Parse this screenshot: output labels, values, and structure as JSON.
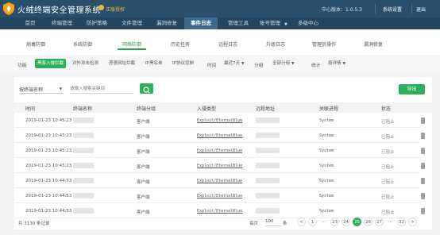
{
  "app": {
    "title": "火绒终端安全管理系统",
    "auth": "正版授权",
    "version": "中心版本：1.0.5.3",
    "settings": "系统设置",
    "exit": "退出"
  },
  "nav": {
    "items": [
      "首页",
      "终端管理",
      "防护策略",
      "文件管理",
      "漏洞修复",
      "事件日志",
      "管理工具",
      "账号管理",
      "多级中心"
    ],
    "active_index": 5
  },
  "subnav": {
    "items": [
      "病毒防御",
      "系统防御",
      "网络防御",
      "历史任务",
      "远程日志",
      "升级日志",
      "管理员操作",
      "漏洞修复"
    ],
    "active_index": 2
  },
  "toolbar": {
    "function_label": "功能",
    "function_buttons": [
      "黑客入侵拦截",
      "对外攻击检测",
      "恶意网址拦截",
      "IP黑名单",
      "IP协议控制"
    ],
    "function_active_index": 0,
    "time_label": "时间",
    "time_value": "最近7天",
    "group_label": "分组",
    "group_value": "全部分组",
    "stat_label": "统计",
    "stat_value": "按详情"
  },
  "filter": {
    "select_value": "按终端名称",
    "search_placeholder": "请输入搜索关键词",
    "export_label": "导出"
  },
  "table": {
    "headers": [
      "时间",
      "终端名称",
      "终端分组",
      "入侵类型",
      "远程地址",
      "关联进程",
      "状态"
    ],
    "rows": [
      {
        "time": "2019-01-23 10:45:23",
        "group": "客户端",
        "type": "Exploit/EternalBlue",
        "process": "System",
        "status": "已阻止"
      },
      {
        "time": "2019-01-23 10:45:23",
        "group": "客户端",
        "type": "Exploit/EternalBlue",
        "process": "System",
        "status": "已阻止"
      },
      {
        "time": "2019-01-23 10:45:23",
        "group": "客户端",
        "type": "Exploit/EternalBlue",
        "process": "System",
        "status": "已阻止"
      },
      {
        "time": "2019-01-23 10:45:23",
        "group": "客户端",
        "type": "Exploit/EternalBlue",
        "process": "System",
        "status": "已阻止"
      },
      {
        "time": "2019-01-23 10:44:53",
        "group": "客户端",
        "type": "Exploit/EternalBlue",
        "process": "System",
        "status": "已阻止"
      },
      {
        "time": "2019-01-23 10:44:53",
        "group": "客户端",
        "type": "Exploit/EternalBlue",
        "process": "System",
        "status": "已阻止"
      },
      {
        "time": "2019-01-23 10:44:53",
        "group": "客户端",
        "type": "Exploit/EternalBlue",
        "process": "System",
        "status": "已阻止"
      }
    ]
  },
  "pagination": {
    "total": "共 3130 条记录",
    "per_page_label": "每页",
    "per_page_value": "100",
    "unit": "条",
    "prev": "<",
    "pages": [
      "1",
      "...",
      "23",
      "24",
      "25",
      "26",
      "27",
      "...",
      "32"
    ],
    "active_page": "25",
    "next": ">"
  },
  "colors": {
    "topbar": "#2b4f6b",
    "navbar": "#24455f",
    "accent_green": "#2bb15a",
    "auth_gold": "#f0b840"
  }
}
